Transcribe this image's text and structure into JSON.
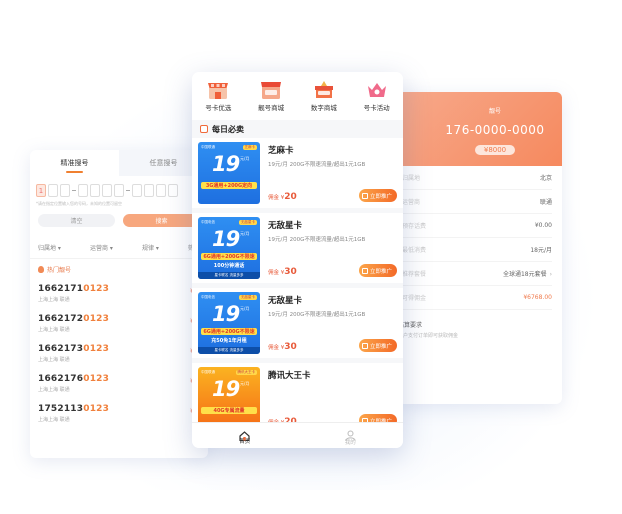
{
  "left_panel": {
    "tabs": [
      "精准搜号",
      "任意搜号"
    ],
    "first_digit": "1",
    "hint": "*请在指定位置输入您的号码，未知的位置可留空",
    "clear_label": "清空",
    "search_label": "搜索",
    "filters": [
      "归属地",
      "运营商",
      "规律",
      "筛选"
    ],
    "section_label": "热门靓号",
    "numbers": [
      {
        "prefix": "1662171",
        "suffix": "0123",
        "sub": "上海上海  联通",
        "price": "¥"
      },
      {
        "prefix": "1662172",
        "suffix": "0123",
        "sub": "上海上海  联通",
        "price": "¥"
      },
      {
        "prefix": "1662173",
        "suffix": "0123",
        "sub": "上海上海  联通",
        "price": "¥"
      },
      {
        "prefix": "1662176",
        "suffix": "0123",
        "sub": "上海上海  联通",
        "price": "¥"
      },
      {
        "prefix": "1752113",
        "suffix": "0123",
        "sub": "上海上海  联通",
        "price": "¥"
      }
    ]
  },
  "right_panel": {
    "label": "靓号",
    "number": "176-0000-0000",
    "price": "¥8000",
    "rows": [
      {
        "k": "归属地",
        "v": "北京"
      },
      {
        "k": "运营商",
        "v": "联通"
      },
      {
        "k": "预存话费",
        "v": "¥0.00"
      },
      {
        "k": "最低消费",
        "v": "18元/月"
      },
      {
        "k": "推荐套餐",
        "v": "全球通18元套餐"
      },
      {
        "k": "可得佣金",
        "v": "¥6768.00"
      }
    ],
    "note_title": "结算要求",
    "note": "用户支付订单即可获取佣金"
  },
  "phone": {
    "categories": [
      {
        "label": "号卡优选",
        "icon": "store-icon"
      },
      {
        "label": "靓号商城",
        "icon": "shop-icon"
      },
      {
        "label": "数字商城",
        "icon": "gift-box-icon"
      },
      {
        "label": "号卡活动",
        "icon": "crown-icon"
      }
    ],
    "daily_title": "每日必卖",
    "products": [
      {
        "name": "芝麻卡",
        "desc": "19元/月 200G不限速流量/超出1元1GB",
        "commission_prefix": "佣金 ¥",
        "commission": "20",
        "button": "立即推广",
        "thumb": {
          "color": "blue",
          "brand": "中国联通",
          "tag": "芝麻卡",
          "big": "19",
          "unit": "元/月",
          "line1": "3G通用+200G定向",
          "line2": "",
          "foot": ""
        }
      },
      {
        "name": "无敌星卡",
        "desc": "19元/月 200G不限速流量/超出1元1GB",
        "commission_prefix": "佣金 ¥",
        "commission": "30",
        "button": "立即推广",
        "thumb": {
          "color": "blue",
          "brand": "中国电信",
          "tag": "无敌星卡",
          "big": "19",
          "unit": "元/月",
          "line1": "6G通用+200G不限速",
          "line2": "100分钟通话",
          "foot": "星卡联名  流量多多"
        }
      },
      {
        "name": "无敌星卡",
        "desc": "19元/月 200G不限速流量/超出1元1GB",
        "commission_prefix": "佣金 ¥",
        "commission": "30",
        "button": "立即推广",
        "thumb": {
          "color": "blue",
          "brand": "中国电信",
          "tag": "无敌星卡",
          "big": "19",
          "unit": "元/月",
          "line1": "6G通用+200G不限速",
          "line2": "充50免1年月租",
          "foot": "星卡联名  流量多多"
        }
      },
      {
        "name": "腾讯大王卡",
        "desc": "",
        "commission_prefix": "佣金 ¥",
        "commission": "20",
        "button": "立即推广",
        "thumb": {
          "color": "orange",
          "brand": "中国联通",
          "tag": "腾讯大王卡",
          "big": "19",
          "unit": "元/月",
          "line1": "40G专属流量",
          "line2": "",
          "foot": ""
        }
      }
    ],
    "tabs": [
      {
        "label": "首页",
        "icon": "home-icon"
      },
      {
        "label": "我的",
        "icon": "user-icon"
      }
    ]
  }
}
